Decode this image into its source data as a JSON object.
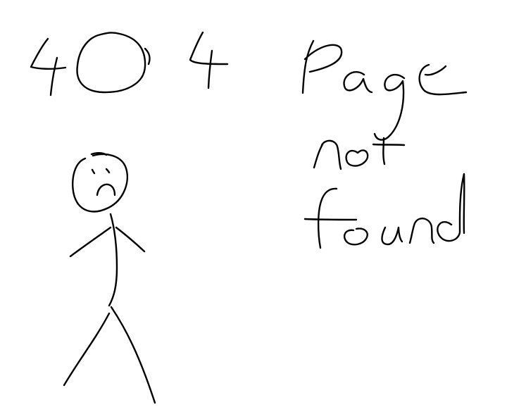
{
  "error": {
    "code": "404",
    "message": "Page not found"
  },
  "illustration": {
    "figure": "sad-stick-figure",
    "color": "#000000",
    "background": "#ffffff"
  }
}
